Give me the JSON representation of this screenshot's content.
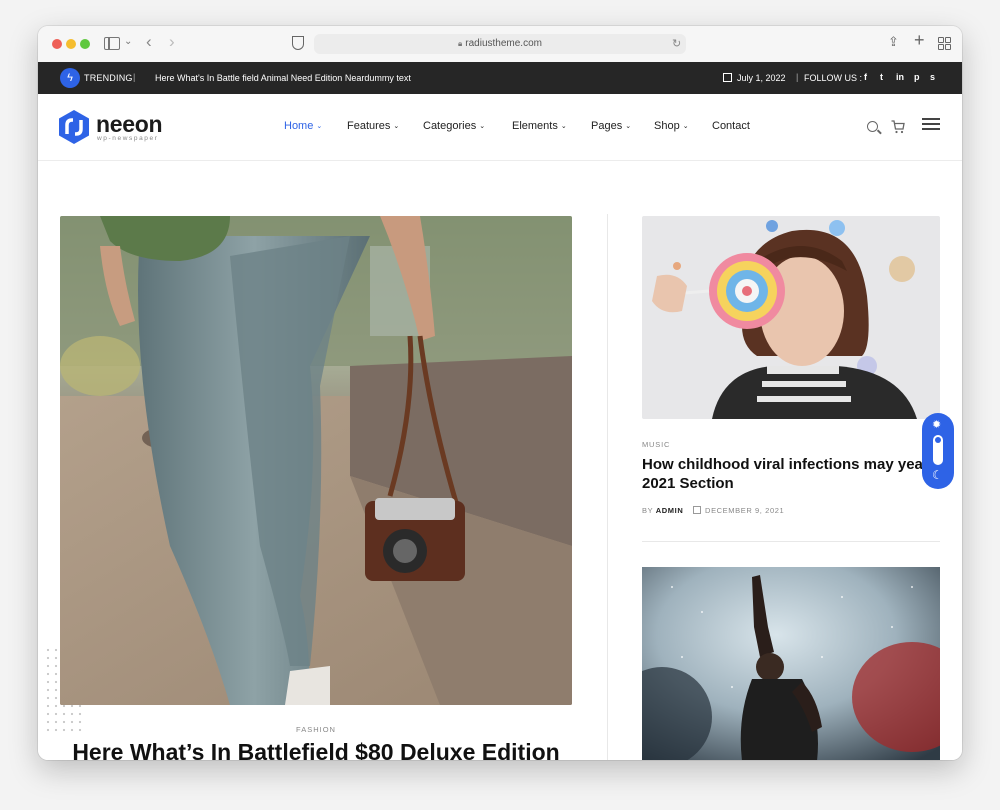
{
  "browser": {
    "url": "radiustheme.com"
  },
  "topbar": {
    "trending_label": "TRENDING",
    "trending_headline": "Here What's In Battle field Animal Need Edition Neardummy text",
    "date": "July 1, 2022",
    "follow_label": "FOLLOW US :",
    "social": [
      "f",
      "t",
      "in",
      "p",
      "s"
    ]
  },
  "header": {
    "logo_name": "neeon",
    "logo_tagline": "wp-newspaper",
    "menu": [
      {
        "label": "Home",
        "caret": "⌄",
        "active": true
      },
      {
        "label": "Features",
        "caret": "⌄"
      },
      {
        "label": "Categories",
        "caret": "⌄"
      },
      {
        "label": "Elements",
        "caret": "⌄"
      },
      {
        "label": "Pages",
        "caret": "⌄"
      },
      {
        "label": "Shop",
        "caret": "⌄"
      },
      {
        "label": "Contact",
        "caret": ""
      }
    ]
  },
  "main_post": {
    "category": "FASHION",
    "title": "Here What’s In Battlefield $80 Deluxe Edition"
  },
  "side_posts": [
    {
      "category": "MUSIC",
      "title": "How childhood viral infections may year 2021 Section",
      "by": "BY",
      "author": "ADMIN",
      "date": "DECEMBER 9, 2021"
    }
  ],
  "colors": {
    "accent": "#2e63e6",
    "topbar_bg": "#262626"
  }
}
